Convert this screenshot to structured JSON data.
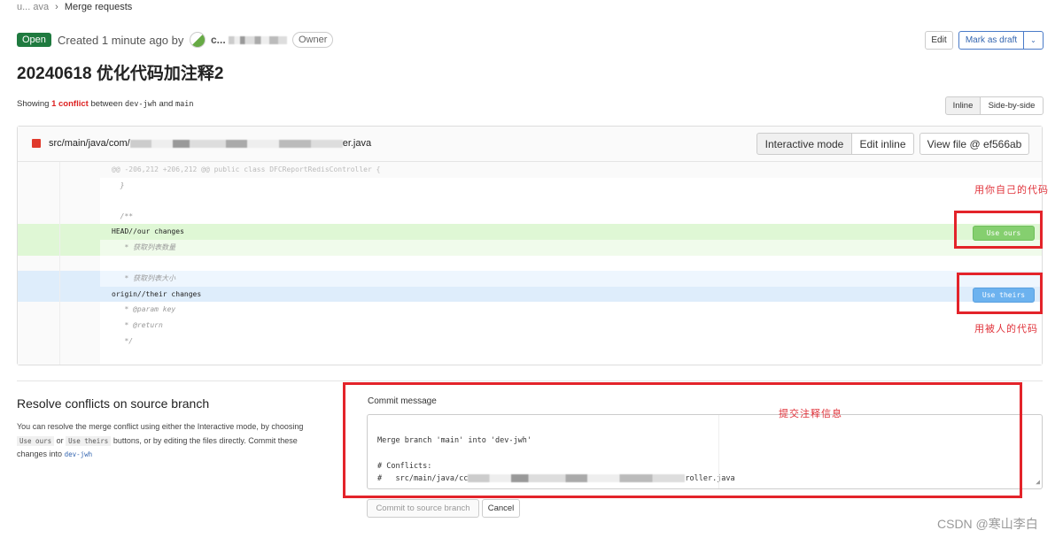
{
  "breadcrumb": {
    "project": "u... ava",
    "current": "Merge requests"
  },
  "header": {
    "status": "Open",
    "created": "Created 1 minute ago by",
    "author": "c...",
    "role": "Owner",
    "edit": "Edit",
    "mark_draft": "Mark as draft"
  },
  "title": "20240618 优化代码加注释2",
  "summary": {
    "showing": "Showing",
    "count": "1 conflict",
    "between": "between",
    "source": "dev-jwh",
    "and": "and",
    "target": "main"
  },
  "view_toggle": {
    "inline": "Inline",
    "side": "Side-by-side"
  },
  "file": {
    "path_start": "src/main/java/com/",
    "path_end": "er.java",
    "interactive": "Interactive mode",
    "edit_inline": "Edit inline",
    "view_file": "View file @ ef566ab"
  },
  "code_lines": [
    "@@ -206,212 +206,212 @@ public class DFCReportRedisController {",
    "  }",
    "",
    "  /**",
    "HEAD//our changes",
    "   * 获取列表数量",
    "",
    "   * 获取列表大小",
    "origin//their changes",
    "   * @param key",
    "   * @return",
    "   */",
    ""
  ],
  "use_ours": "Use ours",
  "use_theirs": "Use theirs",
  "annotations": {
    "ours": "用你自己的代码",
    "theirs": "用被人的代码",
    "commit": "提交注释信息"
  },
  "resolve": {
    "heading": "Resolve conflicts on source branch",
    "p1": "You can resolve the merge conflict using either the Interactive mode, by choosing",
    "code_ours": "Use ours",
    "or": "or",
    "code_theirs": "Use theirs",
    "p2": "buttons, or by editing the files directly. Commit these",
    "p3": "changes into",
    "branch": "dev-jwh"
  },
  "commit": {
    "label": "Commit message",
    "line1": "Merge branch 'main' into 'dev-jwh'",
    "line2": "# Conflicts:",
    "line3_start": "#   src/main/java/cc",
    "line3_end": "roller.java",
    "submit": "Commit to source branch",
    "cancel": "Cancel"
  },
  "watermark": "CSDN @寒山李白"
}
